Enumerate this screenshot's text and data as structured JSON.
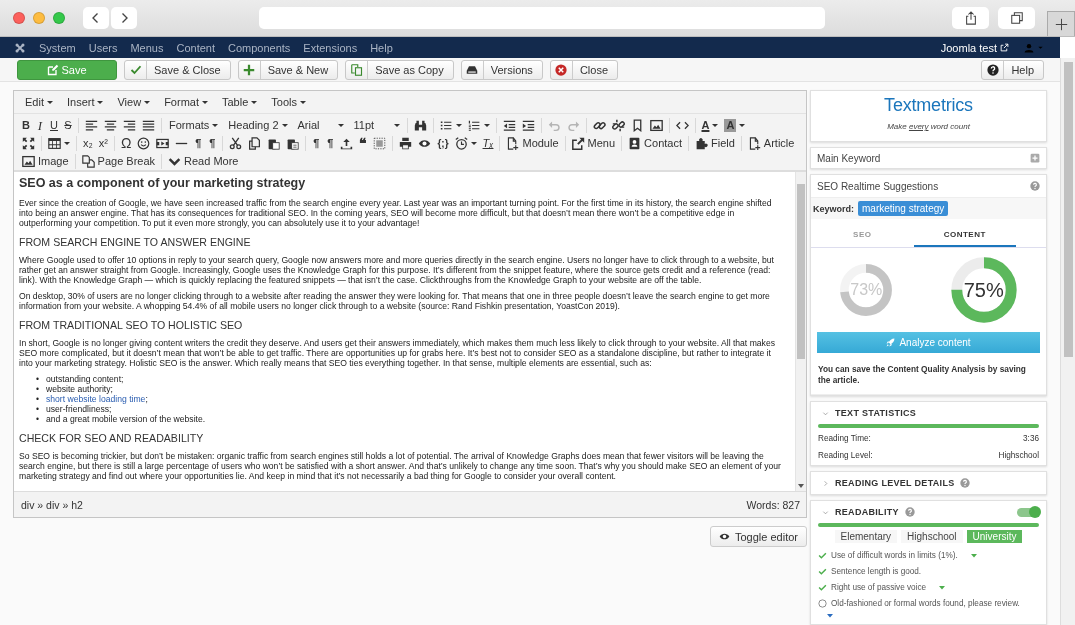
{
  "nav": {
    "items": [
      "System",
      "Users",
      "Menus",
      "Content",
      "Components",
      "Extensions",
      "Help"
    ],
    "site": "Joomla test"
  },
  "toolbar": [
    {
      "kind": "save",
      "label": "Save"
    },
    {
      "kind": "save-close",
      "label": "Save & Close"
    },
    {
      "kind": "save-new",
      "label": "Save & New"
    },
    {
      "kind": "save-copy",
      "label": "Save as Copy"
    },
    {
      "kind": "versions",
      "label": "Versions"
    },
    {
      "kind": "close",
      "label": "Close"
    },
    {
      "kind": "help",
      "label": "Help"
    }
  ],
  "editor": {
    "menus": [
      "Edit",
      "Insert",
      "View",
      "Format",
      "Table",
      "Tools"
    ],
    "toolbar_rows": [
      [
        [
          {
            "kind": "bold",
            "label": "B",
            "disabled": false
          },
          {
            "kind": "italic",
            "label": "I",
            "disabled": false
          },
          {
            "kind": "underline",
            "label": "U",
            "disabled": false
          },
          {
            "kind": "strike",
            "label": "S",
            "disabled": false
          }
        ],
        [
          {
            "kind": "align-left",
            "disabled": false
          },
          {
            "kind": "align-center",
            "disabled": false
          },
          {
            "kind": "align-right",
            "disabled": false
          },
          {
            "kind": "justify",
            "disabled": false
          }
        ],
        [
          {
            "kind": "select",
            "label": "Formats",
            "disabled": false
          },
          {
            "kind": "combo",
            "label": "Heading 2",
            "disabled": false
          },
          {
            "kind": "combo",
            "label": "Arial",
            "disabled": false
          },
          {
            "kind": "combo",
            "label": "11pt",
            "disabled": false
          }
        ],
        [
          {
            "kind": "find",
            "disabled": false
          }
        ],
        [
          {
            "kind": "bullist",
            "disabled": false
          },
          {
            "kind": "numlist",
            "disabled": false
          }
        ],
        [
          {
            "kind": "outdent",
            "disabled": false
          },
          {
            "kind": "indent",
            "disabled": false
          }
        ],
        [
          {
            "kind": "undo",
            "disabled": true
          },
          {
            "kind": "redo",
            "disabled": true
          }
        ],
        [
          {
            "kind": "link",
            "disabled": false
          },
          {
            "kind": "unlink",
            "disabled": false
          },
          {
            "kind": "bookmark",
            "disabled": false
          },
          {
            "kind": "image",
            "disabled": false
          }
        ],
        [
          {
            "kind": "code",
            "disabled": false
          }
        ],
        [
          {
            "kind": "forecolor",
            "label": "A",
            "disabled": false
          },
          {
            "kind": "backcolor",
            "label": "A",
            "disabled": false
          }
        ]
      ],
      [
        [
          {
            "kind": "fullscreen",
            "disabled": false
          }
        ],
        [
          {
            "kind": "table",
            "disabled": false
          }
        ],
        [
          {
            "kind": "sub",
            "label": "x₂",
            "disabled": false
          },
          {
            "kind": "sup",
            "label": "x²",
            "disabled": false
          }
        ],
        [
          {
            "kind": "charmap",
            "label": "Ω",
            "disabled": false
          },
          {
            "kind": "emoticon",
            "disabled": false
          },
          {
            "kind": "media",
            "disabled": false
          },
          {
            "kind": "hr",
            "disabled": false
          },
          {
            "kind": "ltr",
            "label": "¶",
            "disabled": false
          },
          {
            "kind": "rtl",
            "label": "¶",
            "disabled": false
          }
        ],
        [
          {
            "kind": "cut",
            "disabled": false
          },
          {
            "kind": "copy",
            "disabled": false
          },
          {
            "kind": "paste",
            "disabled": false
          },
          {
            "kind": "pastetext",
            "disabled": false
          }
        ],
        [
          {
            "kind": "visualchars",
            "label": "¶",
            "disabled": false
          },
          {
            "kind": "visualblocks",
            "label": "¶",
            "disabled": false
          },
          {
            "kind": "upload",
            "disabled": false
          },
          {
            "kind": "blockquote",
            "label": "❝",
            "disabled": false
          },
          {
            "kind": "visualaid",
            "disabled": false
          }
        ],
        [
          {
            "kind": "print",
            "disabled": false
          },
          {
            "kind": "preview",
            "disabled": false
          },
          {
            "kind": "template",
            "label": "{;}",
            "disabled": false
          },
          {
            "kind": "time",
            "disabled": false
          },
          {
            "kind": "removeformat",
            "label": "Tₓ",
            "disabled": false
          }
        ],
        [
          {
            "kind": "module",
            "label": "Module",
            "disabled": false
          }
        ],
        [
          {
            "kind": "menu",
            "label": "Menu",
            "disabled": false
          }
        ],
        [
          {
            "kind": "contact",
            "label": "Contact",
            "disabled": false
          }
        ],
        [
          {
            "kind": "field",
            "label": "Field",
            "disabled": false
          }
        ],
        [
          {
            "kind": "article",
            "label": "Article",
            "disabled": false
          }
        ]
      ],
      [
        [
          {
            "kind": "image",
            "label": "Image",
            "disabled": false
          }
        ],
        [
          {
            "kind": "pagebreak",
            "label": "Page Break",
            "disabled": false
          }
        ],
        [
          {
            "kind": "readmore",
            "label": "Read More",
            "disabled": false
          }
        ]
      ]
    ],
    "content": [
      {
        "kind": "h2",
        "text": "SEO as a component of your marketing strategy"
      },
      {
        "kind": "p",
        "text": "Ever since the creation of Google, we have seen increased traffic from the search engine every year. Last year was an important turning point. For the first time in its history, the search engine shifted into being an answer engine. That has its consequences for traditional SEO. In the coming years, SEO will become more difficult, but that doesn’t mean there won’t be a competitive edge in outperforming your competition. To put it even more strongly, you can absolutely use it to your advantage!"
      },
      {
        "kind": "h3",
        "text": "FROM SEARCH ENGINE TO ANSWER ENGINE"
      },
      {
        "kind": "p",
        "text": "Where Google used to offer 10 options in reply to your search query, Google now answers more and more queries directly in the search engine. Users no longer have to click through to a website, but rather get an answer straight from Google. Increasingly, Google uses the Knowledge Graph for this purpose. It’s different from the snippet feature, where the source gets credit and a reference (read: link). With the Knowledge Graph — which is quickly replacing the featured snippets — that isn’t the case. Clickthroughs from the Knowledge Graph to your website are off the table."
      },
      {
        "kind": "p",
        "text": "On desktop, 30% of users are no longer clicking through to a website after reading the answer they were looking for. That means that one in three people doesn’t leave the search engine to get more information from your website. A whopping 54.4% of all mobile users no longer click through to a website (source: Rand Fishkin presentation, YoastCon 2019)."
      },
      {
        "kind": "h3",
        "text": "FROM TRADITIONAL SEO TO HOLISTIC SEO"
      },
      {
        "kind": "p",
        "text": "In short, Google is no longer giving content writers the credit they deserve. And users get their answers immediately, which makes them much less likely to click through to your website. All that makes SEO more complicated, but it doesn’t mean that won’t be able to get traffic. There are opportunities up for grabs here. It’s best not to consider SEO as a standalone discipline, but rather to integrate it into your marketing strategy. Holistic SEO is the answer. Which really means that SEO ties everything together. In that sense, multiple elements are essential, such as:"
      },
      {
        "kind": "ul",
        "items": [
          {
            "marker": "•",
            "text": "outstanding content;",
            "link": false
          },
          {
            "marker": "•",
            "text": "website authority;",
            "link": false
          },
          {
            "marker": "•",
            "text": "short website loading time",
            "link": true,
            "tail": ";"
          },
          {
            "marker": "•",
            "text": "user-friendliness;",
            "link": false
          },
          {
            "marker": "•",
            "text": "and a great mobile version of the website.",
            "link": false
          }
        ]
      },
      {
        "kind": "h3",
        "text": "CHECK FOR SEO AND READABILITY"
      },
      {
        "kind": "p",
        "text": "So SEO is becoming trickier, but don’t be mistaken: organic traffic from search engines still holds a lot of potential. The arrival of Knowledge Graphs does mean that fewer visitors will be leaving the search engine, but there is still a large percentage of users who won’t be satisfied with a short answer. And that’s unlikely to change any time soon. That’s why you should make SEO an element of your marketing strategy and find out where your opportunities lie. And keep in mind that it’s not necessarily a bad thing for Google to consider your overall content."
      }
    ],
    "path": "div » div » h2",
    "words": "Words: 827",
    "toggle": "Toggle editor"
  },
  "panel": {
    "logo": "Textmetrics",
    "tagline": {
      "before": "Make ",
      "link": "every",
      "after": " word count"
    },
    "main_keyword": "Main Keyword",
    "suggestions_title": "SEO Realtime Suggestions",
    "keyword_label": "Keyword:",
    "keyword": "marketing strategy",
    "tabs": [
      {
        "label": "SEO",
        "selected": false
      },
      {
        "label": "CONTENT",
        "selected": true
      }
    ],
    "scores": [
      {
        "label": "73%",
        "level": 0.73,
        "active": false
      },
      {
        "label": "75%",
        "level": 0.75,
        "active": true
      }
    ],
    "analyze": "Analyze content",
    "note": "You can save the Content Quality Analysis by saving the article.",
    "sections": [
      {
        "title": "TEXT STATISTICS",
        "expanded": true,
        "help": false,
        "rows": [
          {
            "label": "Reading Time:",
            "value": "3:36"
          },
          {
            "label": "Reading Level:",
            "value": "Highschool"
          }
        ]
      },
      {
        "title": "READING LEVEL DETAILS",
        "expanded": false,
        "help": true
      },
      {
        "title": "READABILITY",
        "expanded": true,
        "help": true,
        "on": true,
        "levels": [
          {
            "label": "Elementary",
            "selected": false
          },
          {
            "label": "Highschool",
            "selected": false
          },
          {
            "label": "University",
            "selected": true
          }
        ],
        "checks": [
          {
            "passed": true,
            "text": "Use of difficult words in limits (1%).",
            "details": true
          },
          {
            "passed": true,
            "text": "Sentence length is good.",
            "details": false
          },
          {
            "passed": true,
            "text": "Right use of passive voice",
            "details": true
          },
          {
            "passed": false,
            "text": "Old-fashioned or formal words found, please review.",
            "details": true
          }
        ]
      }
    ]
  }
}
